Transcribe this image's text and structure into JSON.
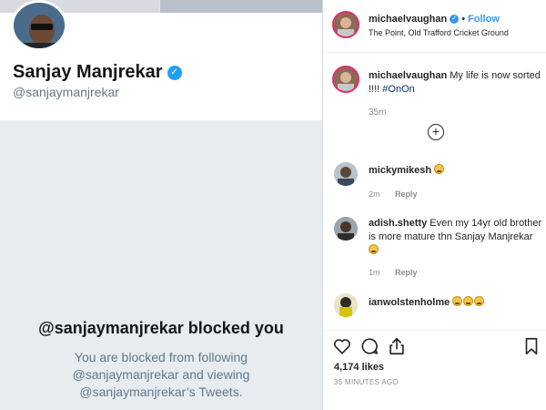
{
  "twitter": {
    "name": "Sanjay Manjrekar",
    "handle": "@sanjaymanjrekar",
    "blocked_title": "@sanjaymanjrekar blocked you",
    "blocked_line1": "You are blocked from following",
    "blocked_line2": "@sanjaymanjrekar and viewing",
    "blocked_line3": "@sanjaymanjrekar’s Tweets.",
    "verified_icon": "verified-badge-icon",
    "accent": "#1da1f2"
  },
  "instagram": {
    "username": "michaelvaughan",
    "follow_label": "Follow",
    "location": "The Point, Old Trafford Cricket Ground",
    "caption_user": "michaelvaughan",
    "caption_text": "My life is now sorted !!!! ",
    "caption_tag": "#OnOn",
    "caption_time": "35m",
    "comments": [
      {
        "user": "mickymikesh",
        "text": "",
        "emoji_count": 1,
        "time": "2m",
        "reply": "Reply"
      },
      {
        "user": "adish.shetty",
        "text": "Even my 14yr old brother is more mature thn Sanjay Manjrekar",
        "emoji_count": 1,
        "time": "1m",
        "reply": "Reply"
      },
      {
        "user": "ianwolstenholme",
        "text": "",
        "emoji_count": 3,
        "time": "",
        "reply": ""
      }
    ],
    "likes": "4,174 likes",
    "post_time": "35 MINUTES AGO",
    "accent": "#3897f0"
  }
}
